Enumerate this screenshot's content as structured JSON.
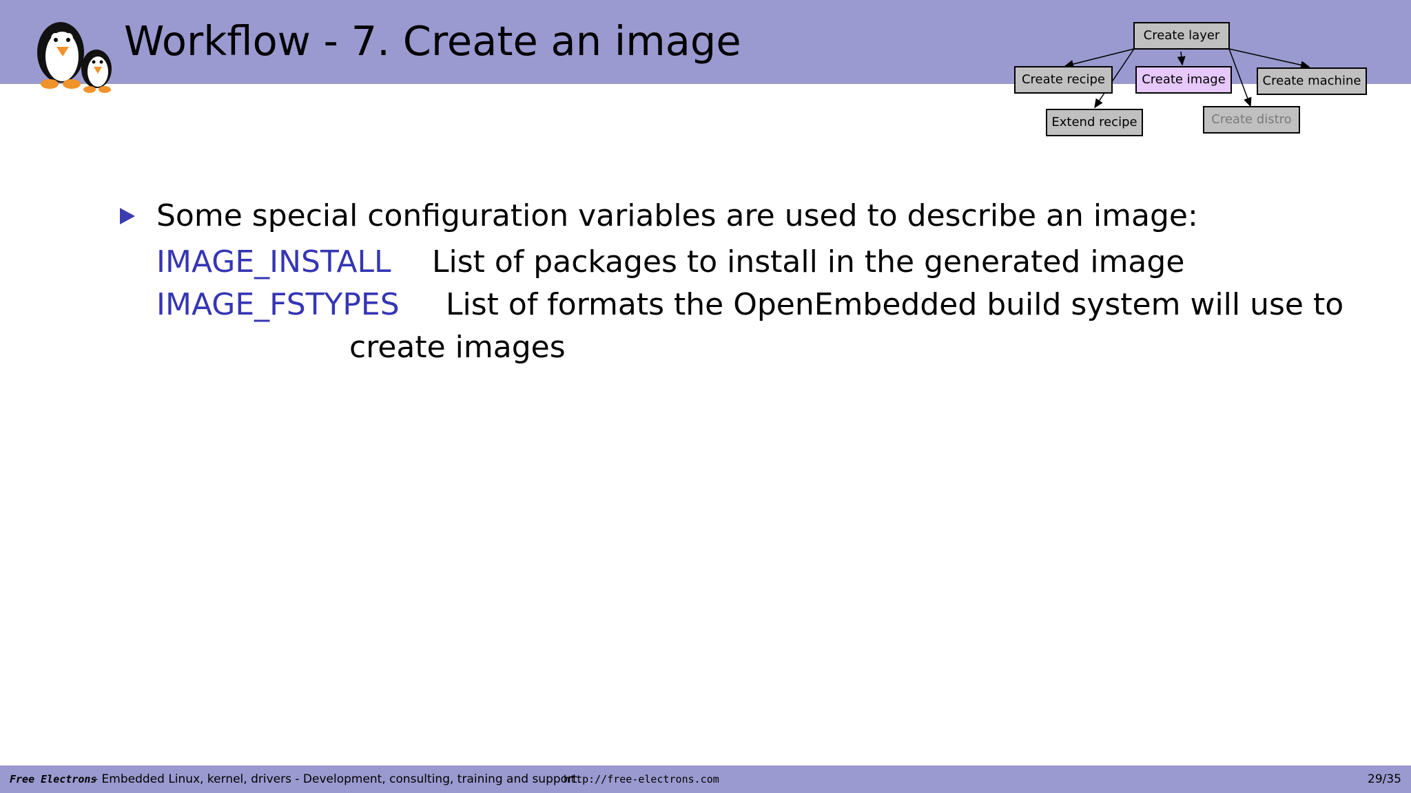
{
  "slide": {
    "title": "Workflow - 7. Create an image",
    "bullet": "Some special configuration variables are used to describe an image:",
    "definitions": [
      {
        "term": "IMAGE_INSTALL",
        "description": "List of packages to install in the generated image"
      },
      {
        "term": "IMAGE_FSTYPES",
        "description": "List of formats the OpenEmbedded build system will use to",
        "description_cont": "create images"
      }
    ]
  },
  "workflow": {
    "create_layer": "Create layer",
    "create_recipe": "Create recipe",
    "create_image": "Create image",
    "create_machine": "Create machine",
    "extend_recipe": "Extend recipe",
    "create_distro": "Create distro"
  },
  "footer": {
    "brand": "Free Electrons",
    "tagline": "- Embedded Linux, kernel, drivers - Development, consulting, training and support.",
    "url": "http://free-electrons.com",
    "page": "29/35"
  },
  "colors": {
    "header_band": "#9a9ad0",
    "accent_blue": "#3535b5",
    "active_box": "#e6c8fa",
    "inactive_box": "#c0c0c0"
  }
}
